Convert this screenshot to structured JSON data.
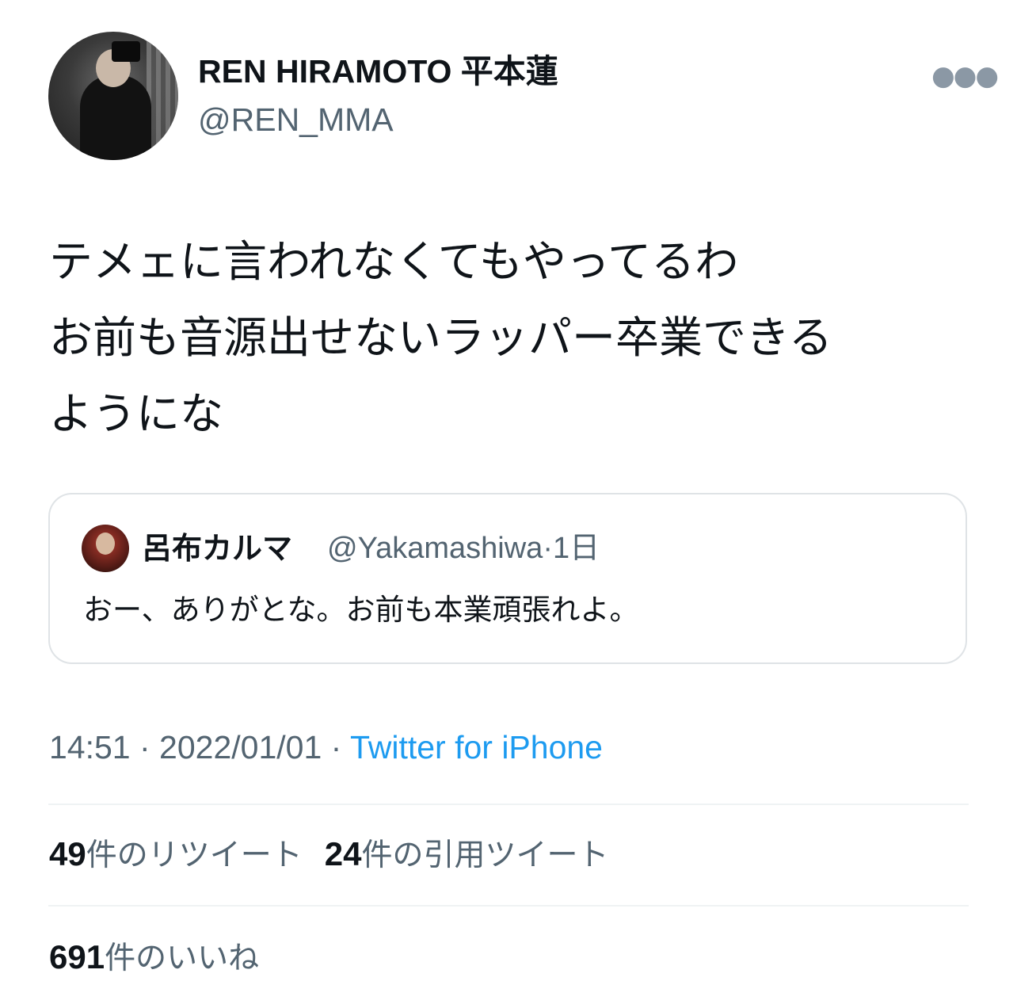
{
  "author": {
    "name": "REN HIRAMOTO 平本蓮",
    "handle": "@REN_MMA"
  },
  "more_icon": "more-dots-icon",
  "tweet": {
    "lines": [
      "テメェに言われなくてもやってるわ",
      "お前も音源出せないラッパー卒業できる",
      "ようにな"
    ]
  },
  "quoted": {
    "name": "呂布カルマ",
    "handle": "@Yakamashiwa",
    "time": "·1日",
    "text": "おー、ありがとな。お前も本業頑張れよ。"
  },
  "meta": {
    "time": "14:51",
    "sep1": " · ",
    "date": "2022/01/01",
    "sep2": " · ",
    "source": "Twitter for iPhone"
  },
  "stats": {
    "retweets_count": "49",
    "retweets_label": "件のリツイート",
    "quotes_count": "24",
    "quotes_label": "件の引用ツイート",
    "likes_count": "691",
    "likes_label": "件のいいね"
  },
  "colors": {
    "link": "#1d9bf0",
    "secondary_text": "#536471",
    "primary_text": "#0f1419",
    "divider": "#eff3f4"
  }
}
